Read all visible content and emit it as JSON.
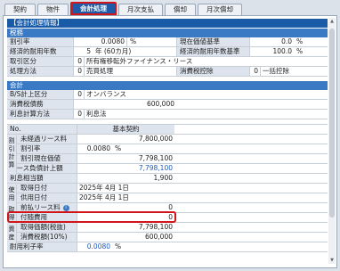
{
  "tabs": [
    {
      "label": "契約",
      "active": false
    },
    {
      "label": "物件",
      "active": false
    },
    {
      "label": "会計処理",
      "active": true
    },
    {
      "label": "月次支払",
      "active": false
    },
    {
      "label": "償却",
      "active": false
    },
    {
      "label": "月次償却",
      "active": false
    }
  ],
  "section_title": "【会計処理情報】",
  "tax": {
    "band": "税務",
    "rows": [
      {
        "left_label": "割引率",
        "left_value": "0.0080",
        "left_unit": "%",
        "right_label": "現在価値基準",
        "right_value": "0.0",
        "right_unit": "%"
      },
      {
        "left_label": "経済的耐用年数",
        "left_value": "5",
        "left_extra": "年 (60カ月)",
        "right_label": "経済的耐用年数基準",
        "right_value": "100.0",
        "right_unit": "%"
      }
    ],
    "torihiki_label": "取引区分",
    "torihiki_code": "0",
    "torihiki_text": "所有権移転外ファイナンス・リース",
    "shori_label": "処理方法",
    "shori_code": "0",
    "shori_text": "売買処理",
    "shohizei_label": "消費税控除",
    "shohizei_code": "0",
    "shohizei_text": "一括控除"
  },
  "accounting": {
    "band": "会計",
    "bs_label": "B/S計上区分",
    "bs_code": "0",
    "bs_text": "オンバランス",
    "tax_debt_label": "消費税債務",
    "tax_debt_value": "600,000",
    "interest_label": "利息計算方法",
    "interest_code": "0",
    "interest_text": "利息法"
  },
  "grid": {
    "no_label": "No.",
    "col_header": "基本契約",
    "side_labels": [
      "割引計算",
      "使用",
      "取得",
      "資産"
    ],
    "rows": [
      {
        "label": "未経過リース料",
        "value": "7,800,000"
      },
      {
        "label": "割引率",
        "value": "0.0080",
        "unit": "%"
      },
      {
        "label": "割引現在価値",
        "value": "7,798,100"
      },
      {
        "label": "リース負債計上額",
        "value": "7,798,100"
      },
      {
        "label": "利息相当額",
        "value": "1,900"
      },
      {
        "label": "取得日付",
        "value": "2025年 4月 1日"
      },
      {
        "label": "供用日付",
        "value": "2025年 4月 1日"
      },
      {
        "label": "前払リース料",
        "value": "0"
      },
      {
        "label": "付随費用",
        "value": "0"
      },
      {
        "label": "取得価額(税抜)",
        "value": "7,798,100"
      },
      {
        "label": "消費税額(10%)",
        "value": "600,000"
      },
      {
        "label": "耐用利子率",
        "value": "0.0080",
        "unit": "%"
      }
    ]
  },
  "colors": {
    "accent": "#1a5ba8",
    "highlight": "#d0161b"
  }
}
